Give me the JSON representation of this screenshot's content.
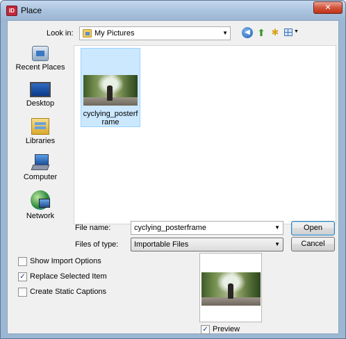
{
  "window": {
    "title": "Place",
    "app_icon_text": "ID",
    "close_glyph": "✕"
  },
  "toolbar": {
    "lookin_label": "Look in:",
    "lookin_value": "My Pictures",
    "icons": [
      "back-icon",
      "up-folder-icon",
      "new-folder-icon",
      "views-menu-icon"
    ]
  },
  "places": [
    {
      "label": "Recent Places",
      "icon": "recent-places-icon"
    },
    {
      "label": "Desktop",
      "icon": "desktop-icon"
    },
    {
      "label": "Libraries",
      "icon": "libraries-icon"
    },
    {
      "label": "Computer",
      "icon": "computer-icon"
    },
    {
      "label": "Network",
      "icon": "network-icon"
    }
  ],
  "files": [
    {
      "name": "cyclying_posterframe",
      "selected": true
    }
  ],
  "form": {
    "filename_label": "File name:",
    "filename_value": "cyclying_posterframe",
    "filetype_label": "Files of type:",
    "filetype_value": "Importable Files"
  },
  "buttons": {
    "open": "Open",
    "cancel": "Cancel"
  },
  "options": [
    {
      "label": "Show Import Options",
      "checked": false
    },
    {
      "label": "Replace Selected Item",
      "checked": true
    },
    {
      "label": "Create Static Captions",
      "checked": false
    }
  ],
  "preview": {
    "label": "Preview",
    "checked": true
  },
  "colors": {
    "selection": "#cce8ff",
    "frame": "#9cb7d4",
    "close": "#c0321a"
  }
}
